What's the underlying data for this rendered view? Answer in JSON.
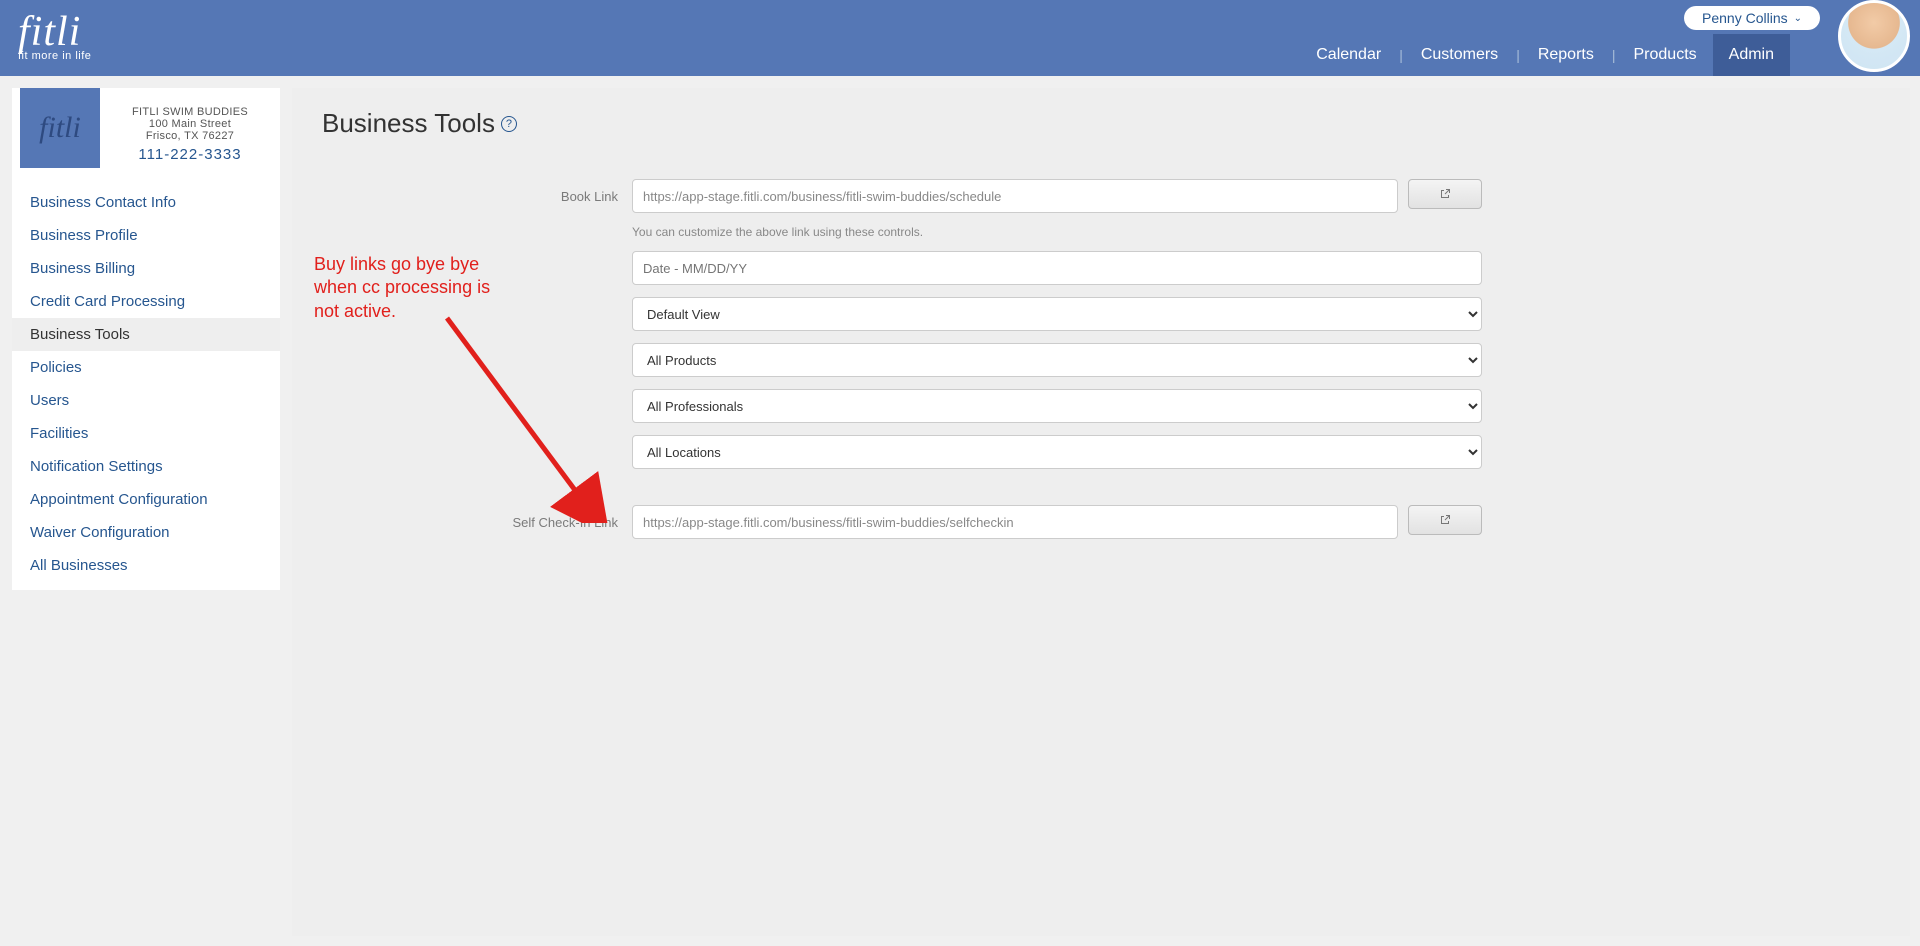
{
  "brand": {
    "logo_text": "fitli",
    "tagline": "fit more in life"
  },
  "user": {
    "name": "Penny Collins"
  },
  "nav": {
    "items": [
      {
        "label": "Calendar"
      },
      {
        "label": "Customers"
      },
      {
        "label": "Reports"
      },
      {
        "label": "Products"
      },
      {
        "label": "Admin"
      }
    ]
  },
  "business": {
    "logo_text": "fitli",
    "name": "FITLI SWIM BUDDIES",
    "address1": "100 Main Street",
    "address2": "Frisco, TX 76227",
    "phone": "111-222-3333"
  },
  "side_nav": [
    {
      "label": "Business Contact Info"
    },
    {
      "label": "Business Profile"
    },
    {
      "label": "Business Billing"
    },
    {
      "label": "Credit Card Processing"
    },
    {
      "label": "Business Tools"
    },
    {
      "label": "Policies"
    },
    {
      "label": "Users"
    },
    {
      "label": "Facilities"
    },
    {
      "label": "Notification Settings"
    },
    {
      "label": "Appointment Configuration"
    },
    {
      "label": "Waiver Configuration"
    },
    {
      "label": "All Businesses"
    }
  ],
  "page": {
    "title": "Business Tools"
  },
  "annotation": "Buy links go bye bye when cc processing is not active.",
  "form": {
    "book_link_label": "Book Link",
    "book_link_value": "https://app-stage.fitli.com/business/fitli-swim-buddies/schedule",
    "customize_hint": "You can customize the above link using these controls.",
    "date_placeholder": "Date - MM/DD/YY",
    "view_select": "Default View",
    "products_select": "All Products",
    "professionals_select": "All Professionals",
    "locations_select": "All Locations",
    "checkin_label": "Self Check-In Link",
    "checkin_value": "https://app-stage.fitli.com/business/fitli-swim-buddies/selfcheckin"
  }
}
